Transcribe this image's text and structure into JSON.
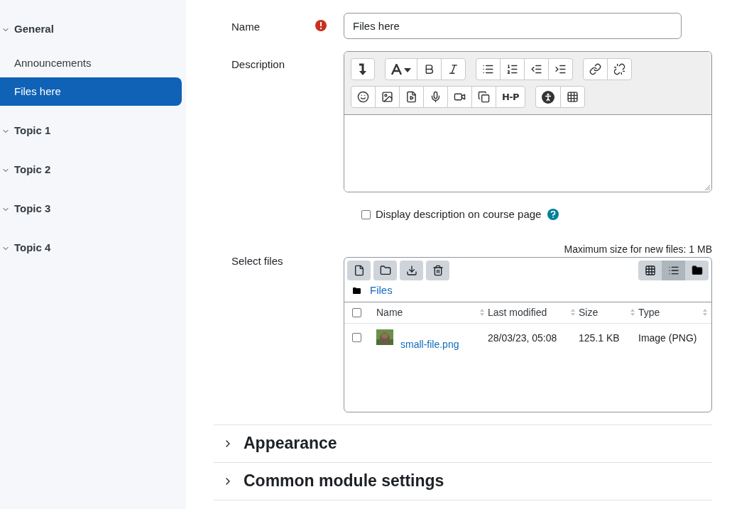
{
  "sidebar": {
    "items": [
      {
        "kind": "section",
        "label": "General",
        "expanded": true
      },
      {
        "kind": "item",
        "label": "Announcements",
        "selected": false
      },
      {
        "kind": "item",
        "label": "Files here",
        "selected": true
      },
      {
        "kind": "section",
        "label": "Topic 1",
        "expanded": true
      },
      {
        "kind": "section",
        "label": "Topic 2",
        "expanded": true
      },
      {
        "kind": "section",
        "label": "Topic 3",
        "expanded": true
      },
      {
        "kind": "section",
        "label": "Topic 4",
        "expanded": true
      }
    ]
  },
  "form": {
    "name": {
      "label": "Name",
      "value": "Files here",
      "required": true
    },
    "description": {
      "label": "Description",
      "h5p_label": "H-P"
    },
    "display_description": {
      "label": "Display description on course page",
      "checked": false
    },
    "files": {
      "label": "Select files",
      "max_size": "Maximum size for new files: 1 MB",
      "views": [
        {
          "selected": false
        },
        {
          "selected": true
        },
        {
          "selected": false
        }
      ],
      "path": "Files",
      "columns": [
        "Name",
        "Last modified",
        "Size",
        "Type"
      ],
      "header_checked": false,
      "rows": [
        {
          "checked": false,
          "name": "small-file.png",
          "modified": "28/03/23, 05:08",
          "size": "125.1 KB",
          "type": "Image (PNG)"
        }
      ]
    }
  },
  "sections": [
    {
      "title": "Appearance",
      "expanded": false
    },
    {
      "title": "Common module settings",
      "expanded": false
    }
  ]
}
